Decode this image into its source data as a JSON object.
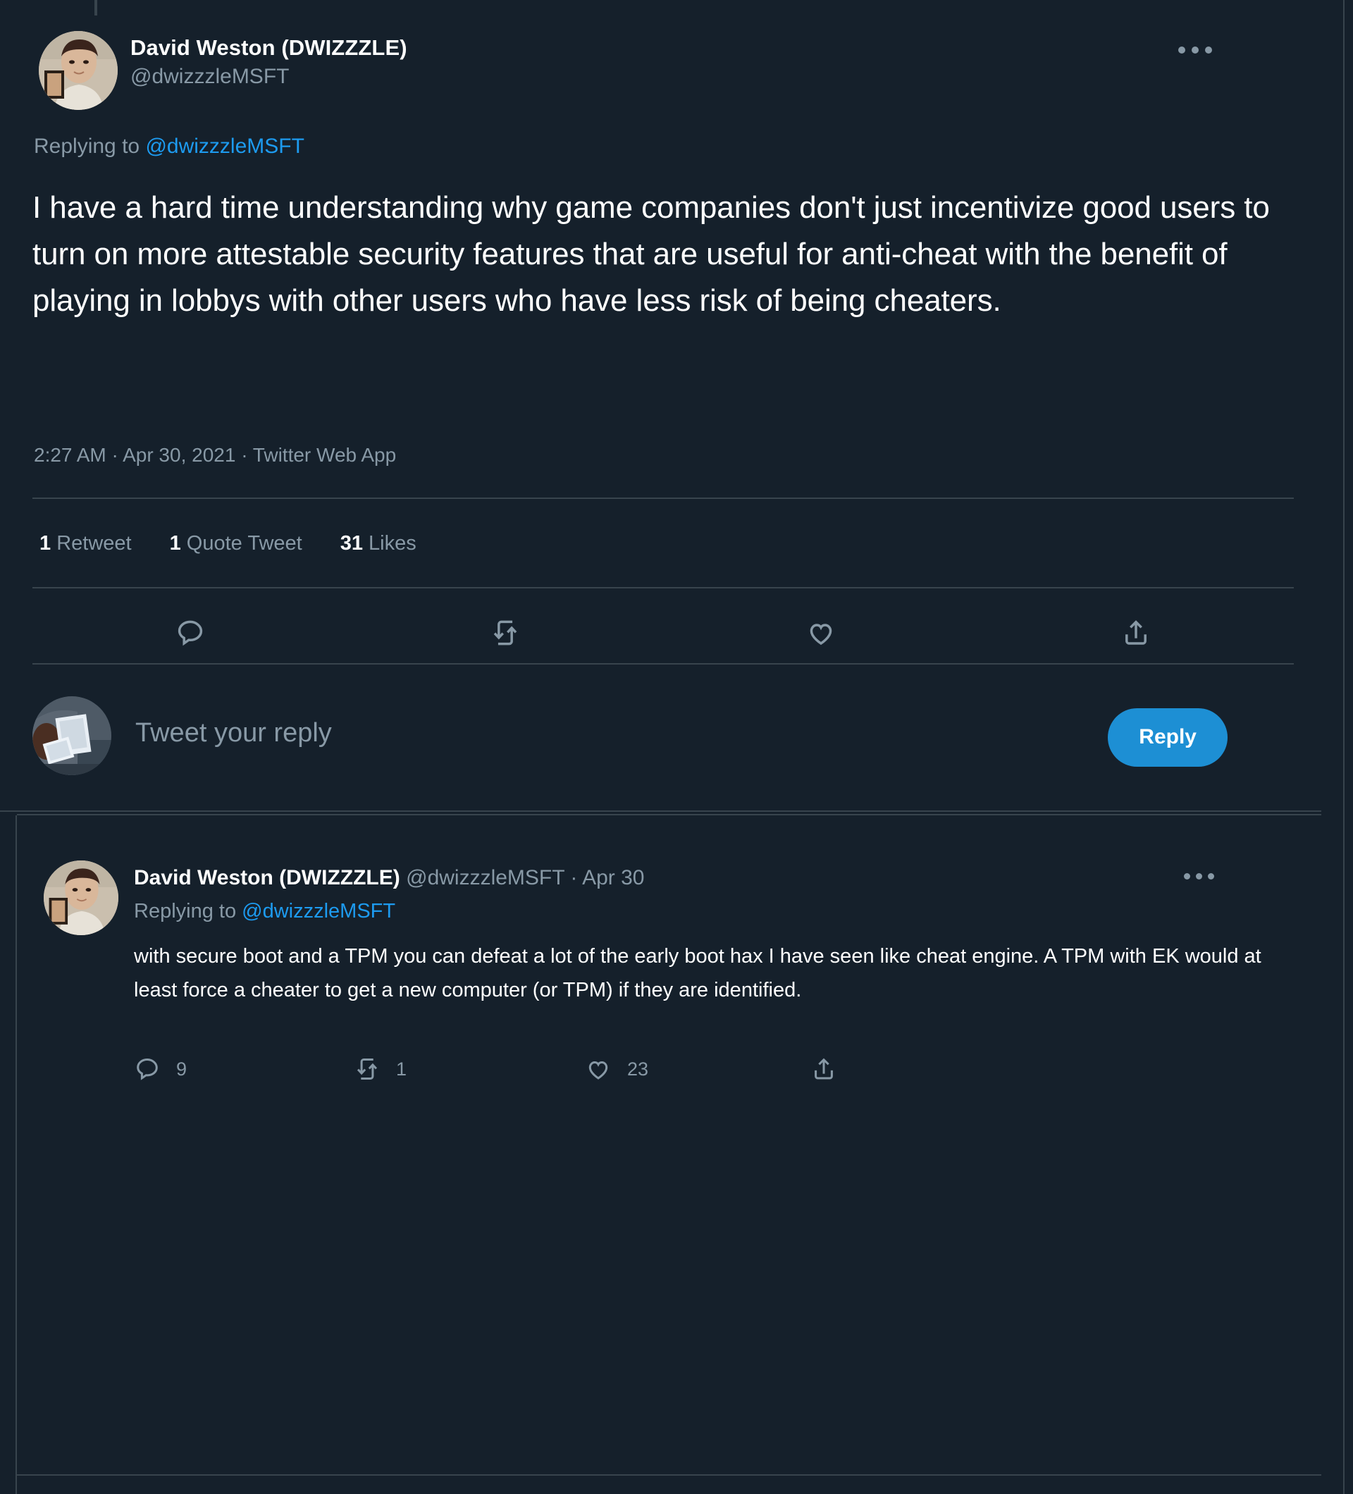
{
  "theme": {
    "background": "#15202b",
    "text_primary": "#ffffff",
    "text_secondary": "#8899a6",
    "link_blue": "#1d9bf0",
    "button_blue": "#1d8fd4",
    "divider": "#38444d"
  },
  "focus_tweet": {
    "display_name": "David Weston (DWIZZZLE)",
    "handle": "@dwizzzleMSFT",
    "more_icon": "more-horizontal-icon",
    "replying_to_label": "Replying to",
    "replying_to_handle": "@dwizzzleMSFT",
    "body": "I have a hard time understanding why game companies don't just incentivize good users to turn on more attestable security features that are useful for anti-cheat with the benefit of playing in lobbys with other users who have less risk of being cheaters.",
    "meta": "2:27 AM · Apr 30, 2021 · Twitter Web App",
    "stats": [
      {
        "count": "1",
        "label": "Retweet"
      },
      {
        "count": "1",
        "label": "Quote Tweet"
      },
      {
        "count": "31",
        "label": "Likes"
      }
    ],
    "actions": [
      {
        "icon": "reply-icon"
      },
      {
        "icon": "retweet-icon"
      },
      {
        "icon": "like-icon"
      },
      {
        "icon": "share-icon"
      }
    ]
  },
  "compose": {
    "placeholder": "Tweet your reply",
    "reply_button_label": "Reply",
    "avatar_name": "your-avatar"
  },
  "reply_tweet": {
    "display_name": "David Weston (DWIZZZLE)",
    "handle": "@dwizzzleMSFT",
    "separator": "·",
    "date": "Apr 30",
    "more_icon": "more-horizontal-icon",
    "replying_to_label": "Replying to",
    "replying_to_handle": "@dwizzzleMSFT",
    "body": "with secure boot and a TPM you can defeat a lot of the early boot hax I have seen like cheat engine.  A TPM with EK would at least force a cheater to get a new computer (or TPM) if they are identified.",
    "actions": [
      {
        "icon": "reply-icon",
        "count": "9"
      },
      {
        "icon": "retweet-icon",
        "count": "1"
      },
      {
        "icon": "like-icon",
        "count": "23"
      },
      {
        "icon": "share-icon",
        "count": ""
      }
    ]
  }
}
